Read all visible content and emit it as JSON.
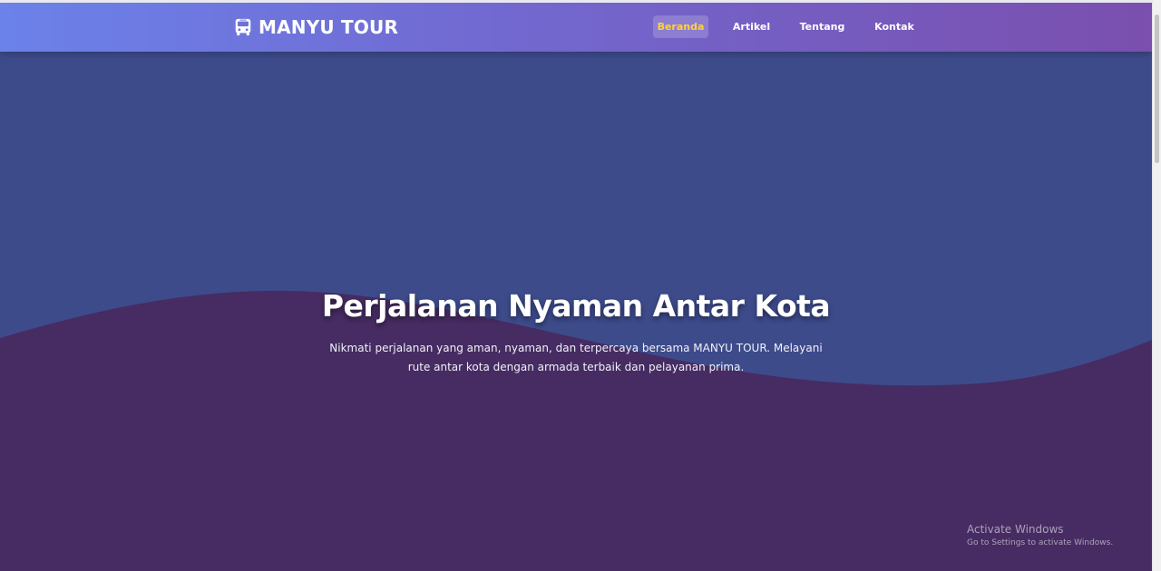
{
  "brand": {
    "name": "MANYU TOUR",
    "icon": "bus-icon"
  },
  "nav": {
    "items": [
      {
        "label": "Beranda",
        "active": true
      },
      {
        "label": "Artikel",
        "active": false
      },
      {
        "label": "Tentang",
        "active": false
      },
      {
        "label": "Kontak",
        "active": false
      }
    ]
  },
  "hero": {
    "title": "Perjalanan Nyaman Antar Kota",
    "subtitle": "Nikmati perjalanan yang aman, nyaman, dan terpercaya bersama MANYU TOUR. Melayani rute antar kota dengan armada terbaik dan pelayanan prima."
  },
  "watermark": {
    "title": "Activate Windows",
    "subtitle": "Go to Settings to activate Windows."
  },
  "colors": {
    "nav_gradient_start": "#6b82ea",
    "nav_gradient_end": "#7a4fae",
    "hero_upper": "#3d4b8b",
    "hero_lower": "#462c62",
    "active_link": "#ffd23c",
    "text": "#ffffff"
  }
}
